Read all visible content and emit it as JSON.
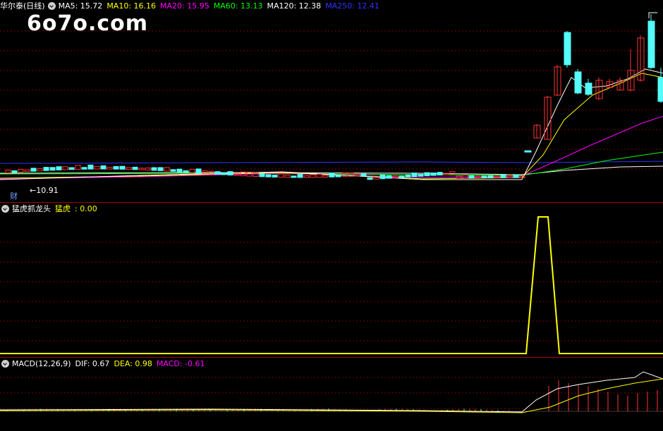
{
  "main": {
    "stock_name": "华尔泰(日线)",
    "ma": [
      {
        "label": "MA5: 15.72",
        "color": "#ffffff"
      },
      {
        "label": "MA10: 16.16",
        "color": "#ffff00"
      },
      {
        "label": "MA20: 15.95",
        "color": "#ff00ff"
      },
      {
        "label": "MA60: 13.13",
        "color": "#00ff00"
      },
      {
        "label": "MA120: 12.38",
        "color": "#ffffff"
      },
      {
        "label": "MA250: 12.41",
        "color": "#3333ff"
      }
    ],
    "watermark": "6o7o.com",
    "low_label": "10.91",
    "finance_icon_label": "财"
  },
  "ind1": {
    "name": "猛虎抓龙头",
    "value_label": "猛虎",
    "value": "0.00"
  },
  "ind2": {
    "name": "MACD(12,26,9)",
    "dif_label": "DIF: 0.67",
    "dea_label": "DEA: 0.98",
    "macd_label": "MACD: -0.61"
  },
  "colors": {
    "up": "#ff3232",
    "down": "#54fcfc",
    "ma5": "#ffffff",
    "ma10": "#ffff00",
    "ma20": "#ff00ff",
    "ma60": "#00ff00",
    "ma120": "#ffffff",
    "ma250": "#3333ff",
    "grid": "#800000"
  }
}
